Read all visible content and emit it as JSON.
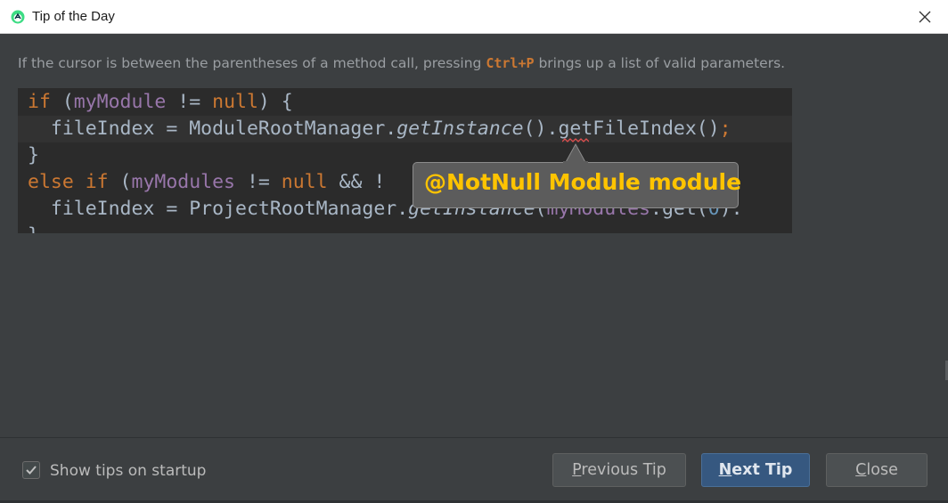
{
  "window": {
    "title": "Tip of the Day",
    "app_icon": "android-studio-icon",
    "close_icon": "close-icon"
  },
  "tip": {
    "before": "If the cursor is between the parentheses of a method call, pressing ",
    "shortcut": "Ctrl+P",
    "after": " brings up a list of valid parameters."
  },
  "code": {
    "line1": {
      "kw_if": "if",
      "open": " (",
      "var": "myModule",
      "op": " != ",
      "kw_null": "null",
      "close": ") {"
    },
    "line2": {
      "prefix": "  fileIndex = ModuleRootManager.",
      "method": "getInstance",
      "suffix": "().getFileIndex()",
      "semi": ";"
    },
    "line3": {
      "text": "}"
    },
    "line4": {
      "kw_else_if": "else if",
      "open": " (",
      "var": "myModules",
      "op": " != ",
      "kw_null": "null",
      "rest": " && !"
    },
    "line5": {
      "prefix": "  fileIndex = ProjectRootManager.",
      "method": "getInstance",
      "open": "(",
      "var": "myModules",
      "mid": ".get(",
      "num": "0",
      "suffix": ")."
    },
    "line6": {
      "text": "}"
    }
  },
  "tooltip": {
    "text": "@NotNull Module module",
    "text_color": "#ffc400"
  },
  "footer": {
    "show_tips_label": "Show tips on startup",
    "show_tips_checked": true,
    "previous_label": "Previous Tip",
    "next_label": "Next Tip",
    "close_label": "Close"
  },
  "colors": {
    "background": "#3c3f41",
    "code_background": "#2b2b2b",
    "keyword": "#cc7832",
    "field": "#9876aa",
    "default_button": "#365880"
  }
}
